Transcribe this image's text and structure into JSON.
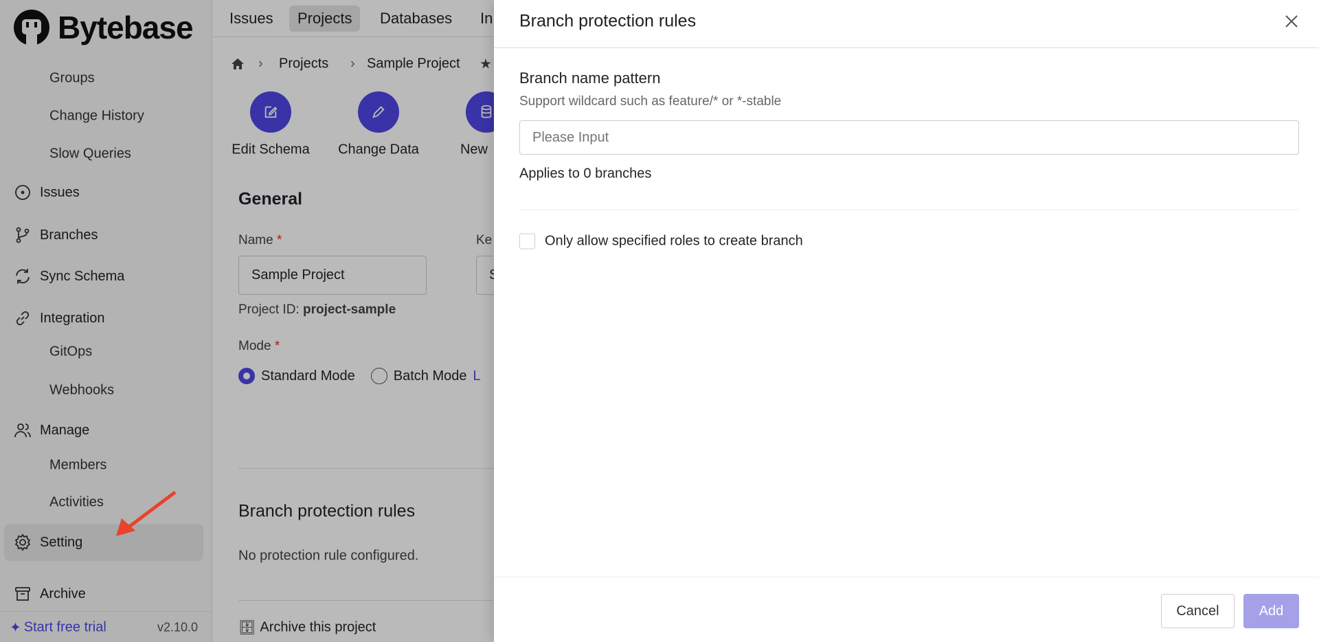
{
  "app": {
    "logo": "Bytebase",
    "version": "v2.10.0",
    "trial": "Start free trial"
  },
  "sidebar": {
    "items": [
      {
        "label": "Groups",
        "sub": true
      },
      {
        "label": "Change History",
        "sub": true
      },
      {
        "label": "Slow Queries",
        "sub": true
      },
      {
        "label": "Issues",
        "icon": "circle-dot-icon"
      },
      {
        "label": "Branches",
        "icon": "git-branch-icon"
      },
      {
        "label": "Sync Schema",
        "icon": "refresh-icon"
      },
      {
        "label": "Integration",
        "icon": "link-icon"
      },
      {
        "label": "GitOps",
        "sub": true
      },
      {
        "label": "Webhooks",
        "sub": true
      },
      {
        "label": "Manage",
        "icon": "users-icon"
      },
      {
        "label": "Members",
        "sub": true
      },
      {
        "label": "Activities",
        "sub": true
      },
      {
        "label": "Setting",
        "icon": "gear-icon",
        "selected": true
      },
      {
        "label": "Archive",
        "icon": "archive-icon"
      }
    ]
  },
  "topnav": [
    "Issues",
    "Projects",
    "Databases",
    "In"
  ],
  "breadcrumb": {
    "items": [
      "Projects",
      "Sample Project"
    ]
  },
  "actions": [
    "Edit Schema",
    "Change Data",
    "New"
  ],
  "general": {
    "title": "General",
    "name_label": "Name",
    "name_value": "Sample Project",
    "key_label": "Ke",
    "key_value": "S",
    "project_id_label": "Project ID:",
    "project_id": "project-sample",
    "mode_label": "Mode",
    "modes": [
      "Standard Mode",
      "Batch Mode"
    ],
    "learn": "L",
    "selected_mode": "Standard Mode"
  },
  "branch_rules": {
    "title": "Branch protection rules",
    "empty": "No protection rule configured."
  },
  "archive_label": "Archive this project",
  "drawer": {
    "title": "Branch protection rules",
    "pattern_label": "Branch name pattern",
    "pattern_hint": "Support wildcard such as feature/* or *-stable",
    "placeholder": "Please Input",
    "value": "",
    "applies": "Applies to 0 branches",
    "checkbox_label": "Only allow specified roles to create branch",
    "checked": false,
    "cancel": "Cancel",
    "add": "Add"
  },
  "colors": {
    "accent": "#4f46e5",
    "add_disabled": "#a5a0e8",
    "annotation_arrow": "#e8432d"
  }
}
